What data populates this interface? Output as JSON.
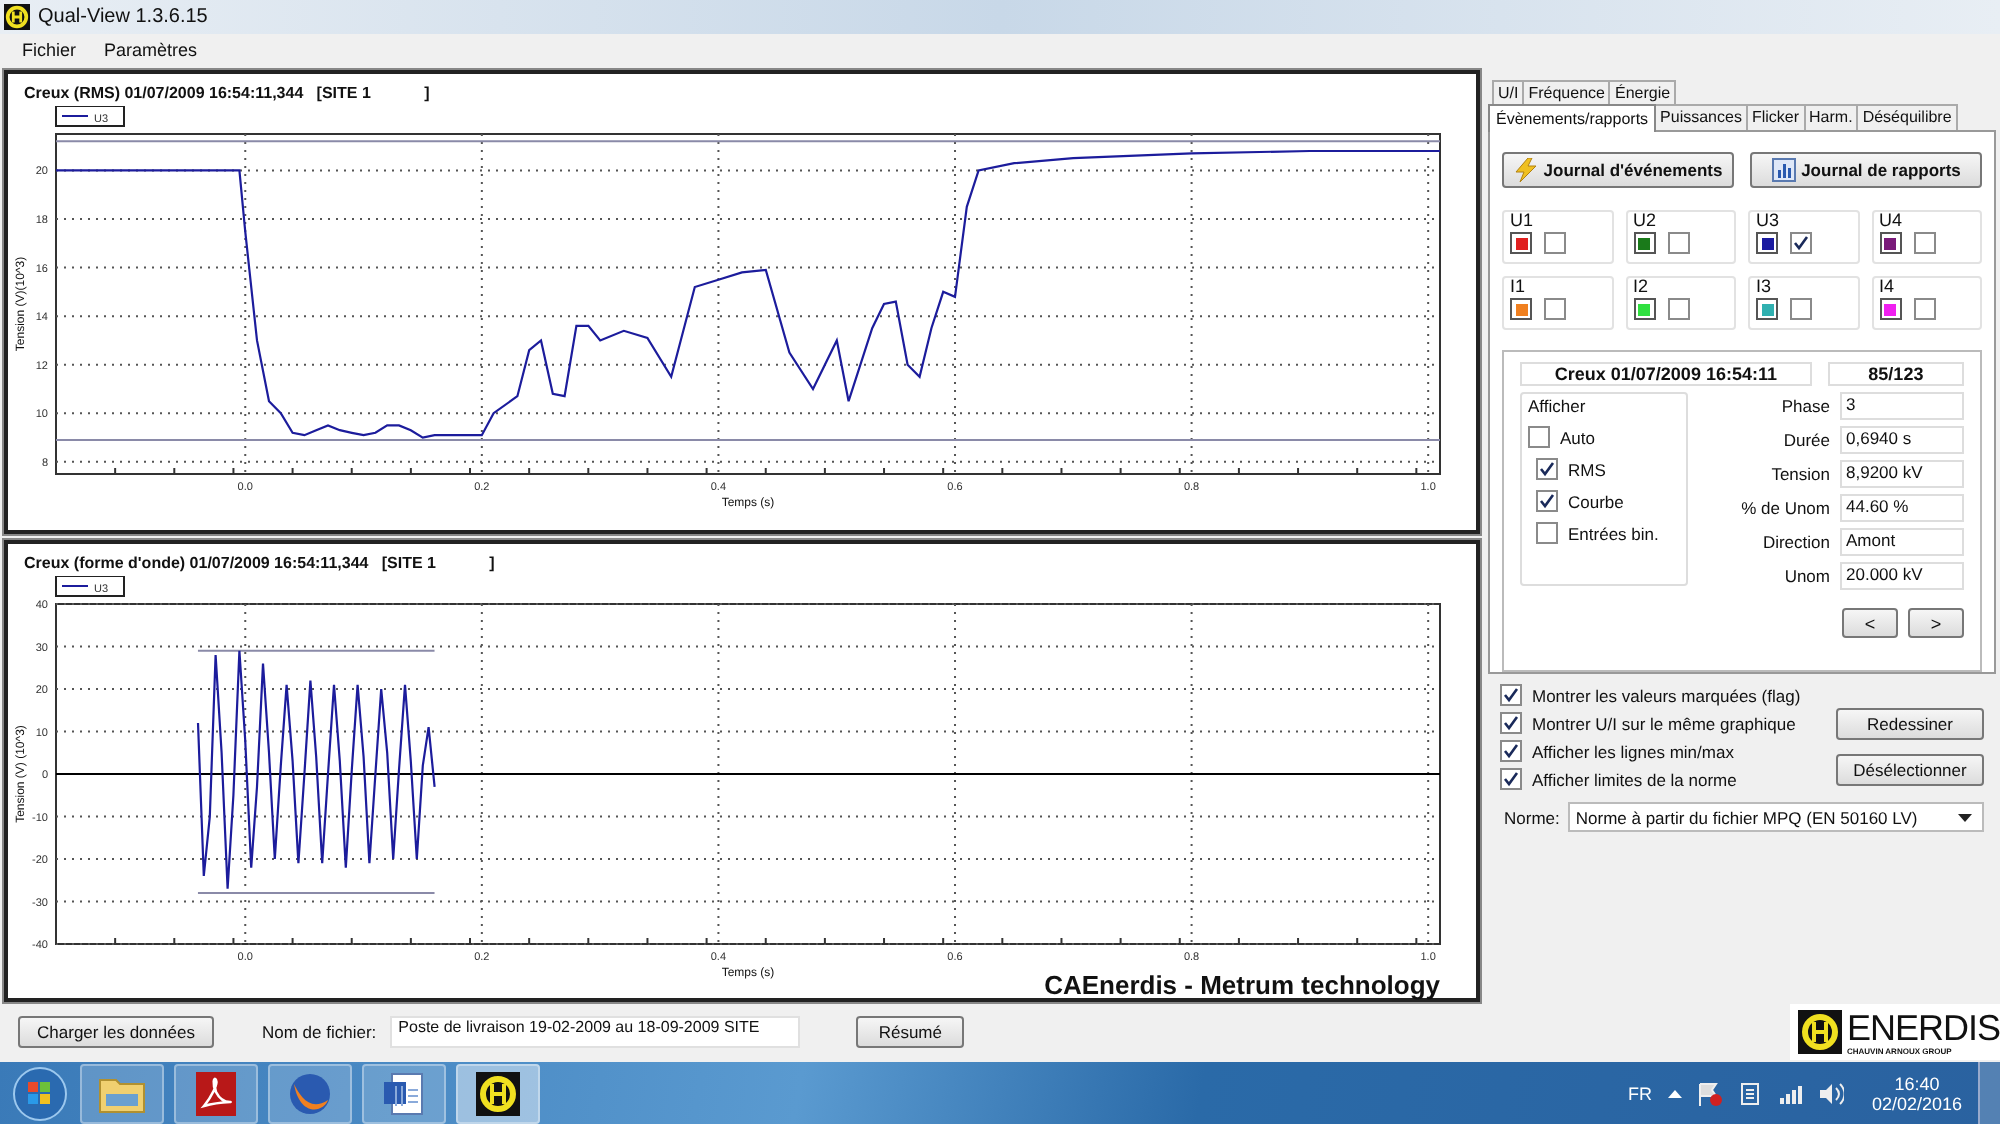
{
  "window": {
    "title": "Qual-View 1.3.6.15"
  },
  "menu": [
    "Fichier",
    "Paramètres"
  ],
  "charts": [
    {
      "title": "Creux (RMS) 01/07/2009 16:54:11,344   [SITE 1            ]",
      "chart_data": {
        "type": "line",
        "xlabel": "Temps (s)",
        "ylabel": "Tension (V)(10^3)",
        "x": [
          -0.16,
          -0.005,
          0.0,
          0.01,
          0.02,
          0.03,
          0.04,
          0.05,
          0.06,
          0.07,
          0.08,
          0.09,
          0.1,
          0.11,
          0.12,
          0.13,
          0.14,
          0.15,
          0.16,
          0.18,
          0.2,
          0.21,
          0.23,
          0.24,
          0.25,
          0.26,
          0.27,
          0.28,
          0.29,
          0.3,
          0.32,
          0.34,
          0.36,
          0.38,
          0.4,
          0.42,
          0.44,
          0.46,
          0.48,
          0.5,
          0.51,
          0.53,
          0.54,
          0.55,
          0.56,
          0.57,
          0.58,
          0.59,
          0.6,
          0.61,
          0.62,
          0.65,
          0.7,
          0.8,
          0.9,
          1.0,
          1.01
        ],
        "series": [
          {
            "name": "U3",
            "color": "#1c1c9c",
            "values": [
              20,
              20,
              17.5,
              13,
              10.5,
              10,
              9.2,
              9.1,
              9.3,
              9.5,
              9.3,
              9.2,
              9.1,
              9.2,
              9.5,
              9.5,
              9.3,
              9.0,
              9.1,
              9.1,
              9.1,
              10,
              10.7,
              12.6,
              13,
              10.8,
              10.7,
              13.6,
              13.6,
              13,
              13.4,
              13.1,
              11.5,
              15.2,
              15.5,
              15.8,
              15.9,
              12.5,
              11,
              13,
              10.5,
              13.5,
              14.5,
              14.6,
              12,
              11.5,
              13.5,
              15,
              14.8,
              18.5,
              20,
              20.3,
              20.5,
              20.7,
              20.8,
              20.8,
              20.8
            ]
          }
        ],
        "xlim": [
          -0.16,
          1.01
        ],
        "ylim": [
          7.5,
          21.5
        ],
        "xticks": [
          {
            "value": 0,
            "label": "0.0"
          },
          {
            "value": 0.2,
            "label": "0.2"
          },
          {
            "value": 0.4,
            "label": "0.4"
          },
          {
            "value": 0.6,
            "label": "0.6"
          },
          {
            "value": 0.8,
            "label": "0.8"
          },
          {
            "value": 1,
            "label": "1.0"
          }
        ],
        "yticks": [
          8,
          10,
          12,
          14,
          16,
          18,
          20
        ],
        "grid": true,
        "ref_lines": [
          {
            "value": 21.2,
            "axis": "y",
            "color": "#8a8aa8"
          },
          {
            "value": 8.9,
            "axis": "y",
            "color": "#8a8aa8"
          }
        ]
      }
    },
    {
      "title": "Creux (forme d'onde) 01/07/2009 16:54:11,344   [SITE 1            ]",
      "footer": "CAEnerdis - Metrum technology",
      "chart_data": {
        "type": "line",
        "xlabel": "Temps (s)",
        "ylabel": "Tension (V) (10^3)",
        "x": [
          -0.04,
          -0.035,
          -0.03,
          -0.025,
          -0.02,
          -0.015,
          -0.01,
          -0.005,
          0.0,
          0.005,
          0.01,
          0.015,
          0.02,
          0.025,
          0.03,
          0.035,
          0.04,
          0.045,
          0.05,
          0.055,
          0.06,
          0.065,
          0.07,
          0.075,
          0.08,
          0.085,
          0.09,
          0.095,
          0.1,
          0.105,
          0.11,
          0.115,
          0.12,
          0.125,
          0.13,
          0.135,
          0.14,
          0.145,
          0.15,
          0.155,
          0.16
        ],
        "series": [
          {
            "name": "U3",
            "color": "#1c1c9c",
            "values": [
              12,
              -24,
              -10,
              28,
              5,
              -27,
              -5,
              29,
              8,
              -22,
              -3,
              26,
              5,
              -20,
              2,
              21,
              3,
              -21,
              0,
              22,
              4,
              -21,
              0,
              21,
              3,
              -22,
              1,
              21,
              4,
              -21,
              0,
              20,
              5,
              -20,
              1,
              21,
              3,
              -20,
              2,
              11,
              -3
            ]
          }
        ],
        "xlim": [
          -0.16,
          1.01
        ],
        "ylim": [
          -40,
          40
        ],
        "xticks": [
          {
            "value": 0,
            "label": "0.0"
          },
          {
            "value": 0.2,
            "label": "0.2"
          },
          {
            "value": 0.4,
            "label": "0.4"
          },
          {
            "value": 0.6,
            "label": "0.6"
          },
          {
            "value": 0.8,
            "label": "0.8"
          },
          {
            "value": 1,
            "label": "1.0"
          }
        ],
        "yticks": [
          -40,
          -30,
          -20,
          -10,
          0,
          10,
          20,
          30,
          40
        ],
        "grid": true,
        "ref_lines": [
          {
            "value": 29,
            "axis": "y",
            "color": "#8a8aa8"
          },
          {
            "value": -28,
            "axis": "y",
            "color": "#8a8aa8"
          }
        ]
      }
    }
  ],
  "right_panel": {
    "tab_rows": [
      {
        "tabs": [
          {
            "label": "U/I",
            "selected": false
          },
          {
            "label": "Fréquence",
            "selected": false
          },
          {
            "label": "Énergie",
            "selected": false
          }
        ]
      },
      {
        "tabs": [
          {
            "label": "Évènements/rapports",
            "selected": true
          },
          {
            "label": "Puissances",
            "selected": false
          },
          {
            "label": "Flicker",
            "selected": false
          },
          {
            "label": "Harm.",
            "selected": false
          },
          {
            "label": "Déséquilibre",
            "selected": false
          }
        ]
      }
    ],
    "journal_buttons": [
      {
        "kind": "events",
        "label": "Journal d'événements"
      },
      {
        "kind": "reports",
        "label": "Journal de rapports"
      }
    ],
    "channels": [
      {
        "name": "U1",
        "color": "#e02020",
        "checked": false
      },
      {
        "name": "U2",
        "color": "#1a7a1a",
        "checked": false
      },
      {
        "name": "U3",
        "color": "#1a1aa0",
        "checked": true
      },
      {
        "name": "U4",
        "color": "#7a1a7a",
        "checked": false
      },
      {
        "name": "I1",
        "color": "#f08020",
        "checked": false
      },
      {
        "name": "I2",
        "color": "#30e040",
        "checked": false
      },
      {
        "name": "I3",
        "color": "#30b0b0",
        "checked": false
      },
      {
        "name": "I4",
        "color": "#f020f0",
        "checked": false
      }
    ],
    "event": {
      "title": "Creux 01/07/2009 16:54:11",
      "counter": "85/123",
      "display": {
        "title": "Afficher",
        "options": [
          {
            "label": "Auto",
            "checked": false
          },
          {
            "label": "RMS",
            "checked": true
          },
          {
            "label": "Courbe",
            "checked": true
          },
          {
            "label": "Entrées bin.",
            "checked": false
          }
        ]
      },
      "fields": [
        {
          "label": "Phase",
          "value": "3"
        },
        {
          "label": "Durée",
          "value": "0,6940 s"
        },
        {
          "label": "Tension",
          "value": "8,9200 kV"
        },
        {
          "label": "% de Unom",
          "value": "44.60 %"
        },
        {
          "label": "Direction",
          "value": "Amont"
        },
        {
          "label": "Unom",
          "value": "20.000 kV"
        }
      ],
      "nav": [
        "<",
        ">"
      ]
    },
    "options": [
      {
        "label": "Montrer les valeurs marquées (flag)",
        "checked": true
      },
      {
        "label": "Montrer U/I sur le même graphique",
        "checked": true
      },
      {
        "label": "Afficher les lignes min/max",
        "checked": true
      },
      {
        "label": "Afficher limites de la norme",
        "checked": true
      }
    ],
    "actions": [
      "Redessiner",
      "Désélectionner"
    ],
    "norme": {
      "label": "Norme:",
      "value": "Norme à partir du fichier MPQ (EN 50160 LV)"
    }
  },
  "bottom_bar": {
    "load_button": "Charger les données",
    "file_label": "Nom de fichier:",
    "file_value": "Poste de livraison 19-02-2009 au 18-09-2009 SITE",
    "summary_button": "Résumé"
  },
  "logo": {
    "name": "ENERDIS",
    "tagline": "CHAUVIN ARNOUX GROUP"
  },
  "taskbar": {
    "language": "FR",
    "time": "16:40",
    "date": "02/02/2016"
  }
}
